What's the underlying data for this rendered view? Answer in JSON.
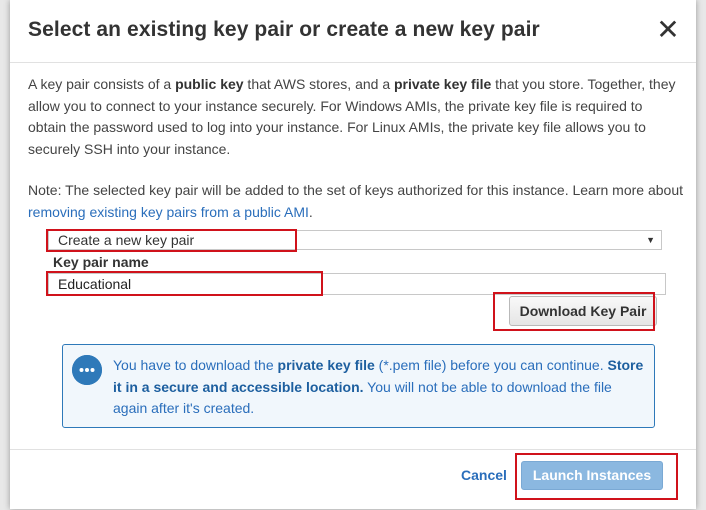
{
  "dialog": {
    "title": "Select an existing key pair or create a new key pair",
    "close_label": "✕"
  },
  "description": {
    "p1_a": "A key pair consists of a ",
    "p1_b": "public key",
    "p1_c": " that AWS stores, and a ",
    "p1_d": "private key file",
    "p1_e": " that you store. Together, they allow you to connect to your instance securely. For Windows AMIs, the private key file is required to obtain the password used to log into your instance. For Linux AMIs, the private key file allows you to securely SSH into your instance.",
    "note_a": "Note: The selected key pair will be added to the set of keys authorized for this instance. Learn more about ",
    "note_link": "removing existing key pairs from a public AMI",
    "note_c": "."
  },
  "keypair": {
    "select_value": "Create a new key pair",
    "name_label": "Key pair name",
    "name_value": "Educational",
    "download_label": "Download Key Pair"
  },
  "info": {
    "t1": "You have to download the ",
    "t2": "private key file",
    "t3": " (*.pem file) before you can continue. ",
    "t4": "Store it in a secure and accessible location.",
    "t5": " You will not be able to download the file again after it's created."
  },
  "footer": {
    "cancel_label": "Cancel",
    "launch_label": "Launch Instances"
  },
  "colors": {
    "highlight_red": "#d0121b",
    "link_blue": "#2a6ebb",
    "launch_button": "#8bb8e0",
    "info_border": "#2e79b9"
  }
}
